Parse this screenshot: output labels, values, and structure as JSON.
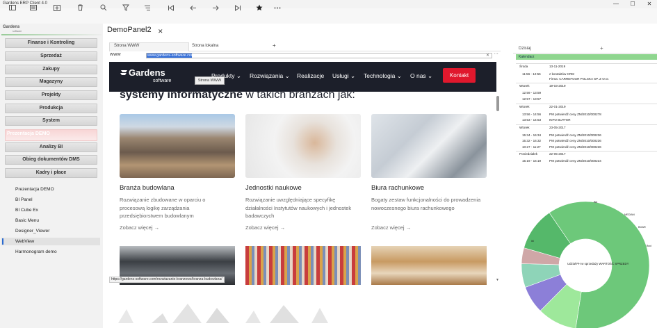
{
  "app": {
    "title": "Gardens ERP Client 4.0"
  },
  "window_buttons": {
    "minimize": "—",
    "maximize": "☐",
    "close": "✕"
  },
  "logo": {
    "name": "Gardens",
    "sub": "software"
  },
  "sidebar": {
    "menu": [
      "Finanse i Kontroling",
      "Sprzedaż",
      "Zakupy",
      "Magazyny",
      "Projekty",
      "Produkcja",
      "System",
      "Prezentacja DEMO",
      "Analizy BI",
      "Obieg dokumentów DMS",
      "Kadry i płace"
    ],
    "active_menu": "Prezentacja DEMO",
    "subitems": [
      "Prezentacja DEMO",
      "BI Panel",
      "BI Cube Ex",
      "Basic Menu",
      "Designer_Viewer",
      "WebView",
      "Harmonogram demo"
    ],
    "selected_subitem": "WebView"
  },
  "panel": {
    "title": "DemoPanel2",
    "close": "✕"
  },
  "tabs": {
    "items": [
      "Strona WWW",
      "Strona lokalna"
    ],
    "add": "+"
  },
  "url": {
    "label": "WWW",
    "value": "www.gardens-software.com",
    "clear": "✕",
    "more": "···"
  },
  "website": {
    "logo": "Gardens",
    "logo_sub": "software",
    "nav": [
      "Produkty",
      "Rozwiązania",
      "Realizacje",
      "Usługi",
      "Technologia",
      "O nas"
    ],
    "contact": "Kontakt",
    "tooltip": "Strona WWW",
    "heading_bold": "systemy informatyczne",
    "heading_rest": " w takich branżach jak:",
    "cards": [
      {
        "title": "Branża budowlana",
        "desc": "Rozwiązanie zbudowane w oparciu o procesową logikę zarządzania przedsiębiorstwem budowlanym",
        "more": "Zobacz więcej"
      },
      {
        "title": "Jednostki naukowe",
        "desc": "Rozwiązanie uwzględniające specyfikę działalności Instytutów naukowych i jednostek badawczych",
        "more": "Zobacz więcej"
      },
      {
        "title": "Biura rachunkowe",
        "desc": "Bogaty zestaw funkcjonalności do prowadzenia nowoczesnego biura rachunkowego",
        "more": "Zobacz więcej"
      }
    ],
    "status_url": "https://gardens-software.com/rozwiazanie-branzowe/branza-budowlana/"
  },
  "right_panel": {
    "tab": "Dzisiaj",
    "add": "+",
    "calendar_header": "Kalendarz",
    "entries": [
      {
        "day": "Środa",
        "date": "13-11-2019"
      },
      {
        "time": "11:56 - 12:56",
        "text": "z kontaktów CRM"
      },
      {
        "time": "",
        "text": "Firma: CARREFOUR POLSKA SP. Z O.O."
      },
      {
        "day": "Wtorek",
        "date": "19-03-2019"
      },
      {
        "time": "12:59 - 13:59",
        "text": ""
      },
      {
        "time": "12:57 - 13:57",
        "text": ""
      },
      {
        "day": "Wtorek",
        "date": "22-01-2019"
      },
      {
        "time": "13:56 - 14:56",
        "text": "PM potwierdź ceny ZM/2010/000278"
      },
      {
        "time": "13:53 - 14:53",
        "text": "INFO BUTTER"
      },
      {
        "day": "Wtorek",
        "date": "23-05-2017"
      },
      {
        "time": "15:34 - 16:34",
        "text": "PM potwierdź ceny ZM/2010/000236"
      },
      {
        "time": "15:32 - 16:32",
        "text": "PM potwierdź ceny ZM/2010/000236"
      },
      {
        "time": "10:27 - 11:27",
        "text": "PM potwierdź ceny ZM/2010/000236"
      },
      {
        "day": "Poniedziałek",
        "date": "22-05-2017"
      },
      {
        "time": "15:19 - 16:19",
        "text": "PM potwierdź ceny ZM/2010/000234"
      }
    ]
  },
  "donut": {
    "center_text": "Udział PH w sprzedaży WARTOŚĆ SPRZEDY",
    "labels": [
      "Bik",
      "MEDIAN",
      "BOAR",
      "Bnd",
      "Ibl"
    ],
    "colors": [
      "#6dc87a",
      "#9ee89b",
      "#8c7fd8",
      "#8ed4b8",
      "#cfa7a7",
      "#55b86a"
    ],
    "shares": [
      0.62,
      0.1,
      0.07,
      0.06,
      0.04,
      0.11
    ]
  }
}
